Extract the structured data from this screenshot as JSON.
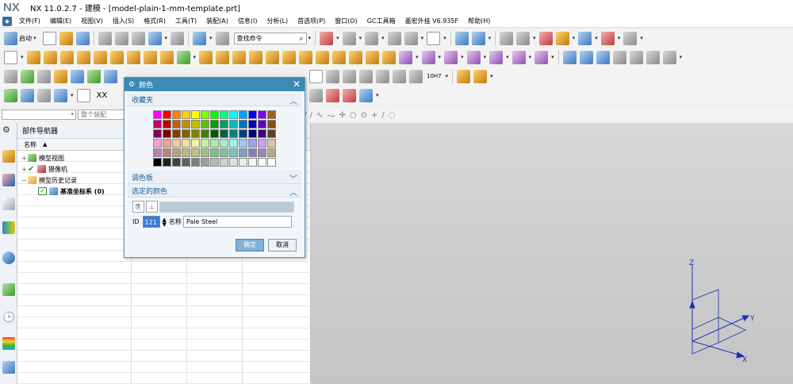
{
  "titlebar": {
    "logo": "NX",
    "title": "NX 11.0.2.7 - 建模 - [model-plain-1-mm-template.prt]"
  },
  "menubar": {
    "items": [
      "文件(F)",
      "编辑(E)",
      "视图(V)",
      "插入(S)",
      "格式(R)",
      "工具(T)",
      "装配(A)",
      "信息(I)",
      "分析(L)",
      "首选项(P)",
      "窗口(O)",
      "GC工具箱",
      "墨宏外挂 V6.935F",
      "帮助(H)"
    ]
  },
  "toolbar": {
    "launch_label": "启动",
    "search_placeholder": "查找命令",
    "tol_label": "10H7",
    "xx_label": "XX"
  },
  "filter": {
    "placeholder": "整个装配"
  },
  "navigator": {
    "title": "部件导航器",
    "column_name": "名称",
    "tree": [
      {
        "expander": "+",
        "label": "模型视图"
      },
      {
        "expander": "+",
        "label": "摄像机"
      },
      {
        "expander": "−",
        "label": "模型历史记录"
      },
      {
        "expander": "",
        "label": "基准坐标系 (0)"
      }
    ]
  },
  "dialog": {
    "title": "颜色",
    "sections": {
      "favorites": "收藏夹",
      "palette": "调色板",
      "selected": "选定的颜色"
    },
    "palette_colors": [
      "#ff00ff",
      "#ff0000",
      "#ff8000",
      "#ffd000",
      "#ffff00",
      "#80ff00",
      "#00ff00",
      "#00ff80",
      "#00ffff",
      "#00a0ff",
      "#0000ff",
      "#8000ff",
      "#a06020",
      "#c0006a",
      "#c00000",
      "#c06000",
      "#c09000",
      "#c0c000",
      "#60c000",
      "#00a000",
      "#00a060",
      "#00c0c0",
      "#0070c0",
      "#0000c0",
      "#6000c0",
      "#805020",
      "#800060",
      "#800000",
      "#804000",
      "#806000",
      "#808000",
      "#408000",
      "#006000",
      "#006040",
      "#008080",
      "#004080",
      "#000080",
      "#400080",
      "#604020",
      "#f0a0d0",
      "#f0a0a0",
      "#f0c8a0",
      "#f0e0a0",
      "#f0f0a0",
      "#c8f0a0",
      "#a0f0a0",
      "#a0f0c8",
      "#a0f0f0",
      "#a0c8f0",
      "#a0a0f0",
      "#c8a0f0",
      "#d8c8a8",
      "#c080b0",
      "#c08080",
      "#c0a080",
      "#c0b880",
      "#c0c080",
      "#a0c080",
      "#80c080",
      "#80c0a0",
      "#80c0c0",
      "#80a0c0",
      "#8080c0",
      "#a080c0",
      "#b8a888",
      "#000000",
      "#202020",
      "#404040",
      "#606060",
      "#808080",
      "#a0a0a0",
      "#b8b8b8",
      "#d0d0d0",
      "#e0e0e0",
      "#ececec",
      "#f6f6f6",
      "#ffffff",
      "#ffffff"
    ],
    "selected_color": "#b9cad7",
    "id_label": "ID",
    "id_value": "121",
    "name_label": "名称",
    "name_value": "Pale Steel",
    "ok_label": "确定",
    "cancel_label": "取消"
  },
  "triad": {
    "z": "Z",
    "y": "Y",
    "x": "X"
  }
}
